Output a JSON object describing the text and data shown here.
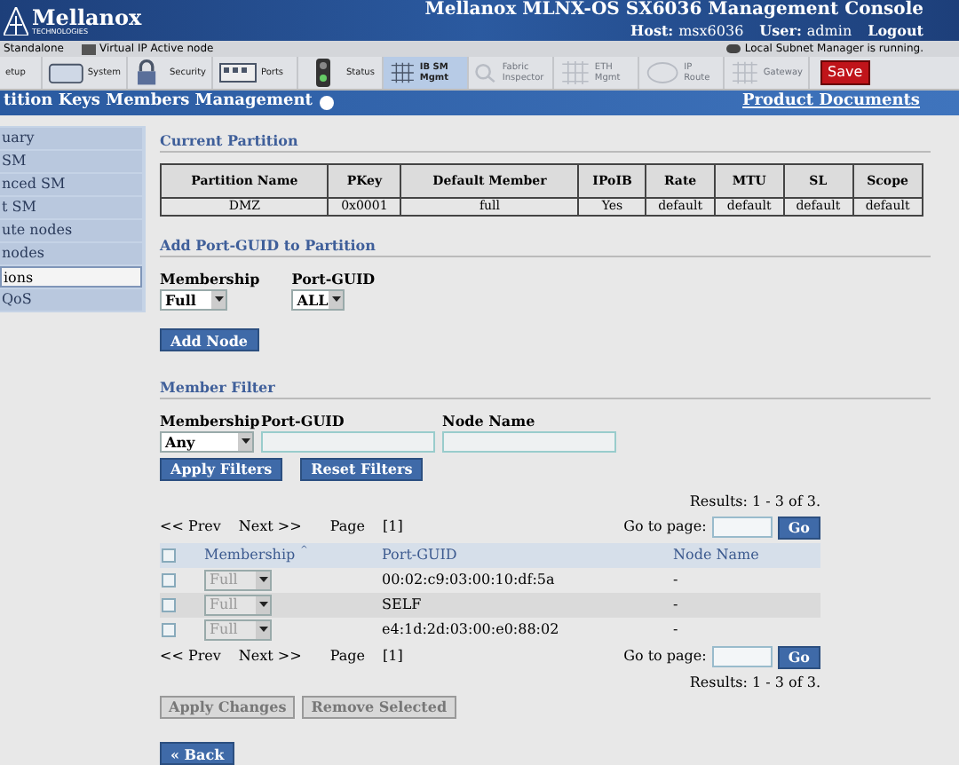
{
  "header": {
    "brand": "Mellanox",
    "brand_sub": "TECHNOLOGIES",
    "title": "Mellanox MLNX-OS SX6036 Management Console",
    "host_label": "Host:",
    "host": "msx6036",
    "user_label": "User:",
    "user": "admin",
    "logout": "Logout"
  },
  "status_bar": {
    "mode": "Standalone",
    "vip": "Virtual IP Active node",
    "sm_status": "Local Subnet Manager is running."
  },
  "toolbar": [
    {
      "label": "etup",
      "kind": "tool",
      "selected": false,
      "disabled": false
    },
    {
      "label": "System",
      "kind": "tool",
      "selected": false,
      "disabled": false
    },
    {
      "label": "Security",
      "kind": "tool",
      "selected": false,
      "disabled": false
    },
    {
      "label": "Ports",
      "kind": "tool",
      "selected": false,
      "disabled": false
    },
    {
      "label": "Status",
      "kind": "tool",
      "selected": false,
      "disabled": false
    },
    {
      "label": "IB SM Mgmt",
      "kind": "tool",
      "selected": true,
      "disabled": false
    },
    {
      "label": "Fabric Inspector",
      "kind": "tool",
      "selected": false,
      "disabled": true
    },
    {
      "label": "ETH Mgmt",
      "kind": "tool",
      "selected": false,
      "disabled": true
    },
    {
      "label": "IP Route",
      "kind": "tool",
      "selected": false,
      "disabled": true
    },
    {
      "label": "Gateway",
      "kind": "tool",
      "selected": false,
      "disabled": true
    },
    {
      "label": "Save",
      "kind": "save"
    }
  ],
  "page_title": "tition Keys Members Management",
  "product_docs": "Product Documents",
  "sidebar": {
    "items": [
      {
        "label": "uary",
        "selected": false
      },
      {
        "label": "SM",
        "selected": false
      },
      {
        "label": "nced SM",
        "selected": false
      },
      {
        "label": "t SM",
        "selected": false
      },
      {
        "label": "ute nodes",
        "selected": false
      },
      {
        "label": "nodes",
        "selected": false
      },
      {
        "label": "ions",
        "selected": true
      },
      {
        "label": "QoS",
        "selected": false
      }
    ]
  },
  "current_partition": {
    "heading": "Current Partition",
    "columns": [
      "Partition Name",
      "PKey",
      "Default Member",
      "IPoIB",
      "Rate",
      "MTU",
      "SL",
      "Scope"
    ],
    "row": [
      "DMZ",
      "0x0001",
      "full",
      "Yes",
      "default",
      "default",
      "default",
      "default"
    ]
  },
  "add_port": {
    "heading": "Add Port-GUID to Partition",
    "membership_label": "Membership",
    "membership": "Full",
    "guid_label": "Port-GUID",
    "guid": "ALL",
    "button": "Add Node"
  },
  "filter": {
    "heading": "Member Filter",
    "membership_label": "Membership",
    "membership": "Any",
    "guid_label": "Port-GUID",
    "node_label": "Node Name",
    "apply": "Apply Filters",
    "reset": "Reset Filters"
  },
  "members": {
    "results_top": "Results: 1 - 3 of 3.",
    "goto_top": "Go to page:",
    "go_top": "Go",
    "prev_top": "<< Prev",
    "next_top": "Next >>",
    "page_top": "Page",
    "page_num_top": "[1]",
    "columns": [
      "Membership",
      "Port-GUID",
      "Node Name"
    ],
    "sort_mark": "^",
    "header_checked": false,
    "rows": [
      {
        "checked": false,
        "membership": "Full",
        "guid": "00:02:c9:03:00:10:df:5a",
        "node": "-"
      },
      {
        "checked": false,
        "membership": "Full",
        "guid": "SELF",
        "node": "-"
      },
      {
        "checked": false,
        "membership": "Full",
        "guid": "e4:1d:2d:03:00:e0:88:02",
        "node": "-"
      }
    ],
    "prev_bottom": "<< Prev",
    "next_bottom": "Next >>",
    "page_bottom": "Page",
    "page_num_bottom": "[1]",
    "goto_bottom": "Go to page:",
    "go_bottom": "Go",
    "results_bottom": "Results: 1 - 3 of 3.",
    "apply_changes": "Apply Changes",
    "remove_selected": "Remove Selected",
    "back": "« Back"
  }
}
